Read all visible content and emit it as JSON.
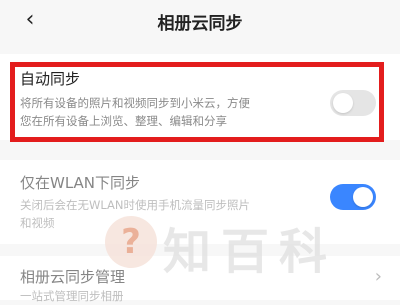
{
  "header": {
    "back_icon": "chevron-left-icon",
    "back_glyph": "‹",
    "title": "相册云同步"
  },
  "auto_sync": {
    "title": "自动同步",
    "description_line1": "将所有设备的照片和视频同步到小米云，方便",
    "description_line2": "您在所有设备上浏览、整理、编辑和分享",
    "toggle_state": "off"
  },
  "wlan_sync": {
    "title": "仅在WLAN下同步",
    "description_line1": "关闭后会在无WLAN时使用手机流量同步照片",
    "description_line2": "和视频",
    "toggle_state": "on"
  },
  "sync_manage": {
    "title": "相册云同步管理",
    "description": "一站式管理同步相册"
  },
  "watermark": {
    "logo_glyph": "?",
    "text": "知百科"
  },
  "colors": {
    "highlight": "#e31d1d",
    "toggle_on": "#3a86ff",
    "toggle_off": "#e5e5e5"
  }
}
